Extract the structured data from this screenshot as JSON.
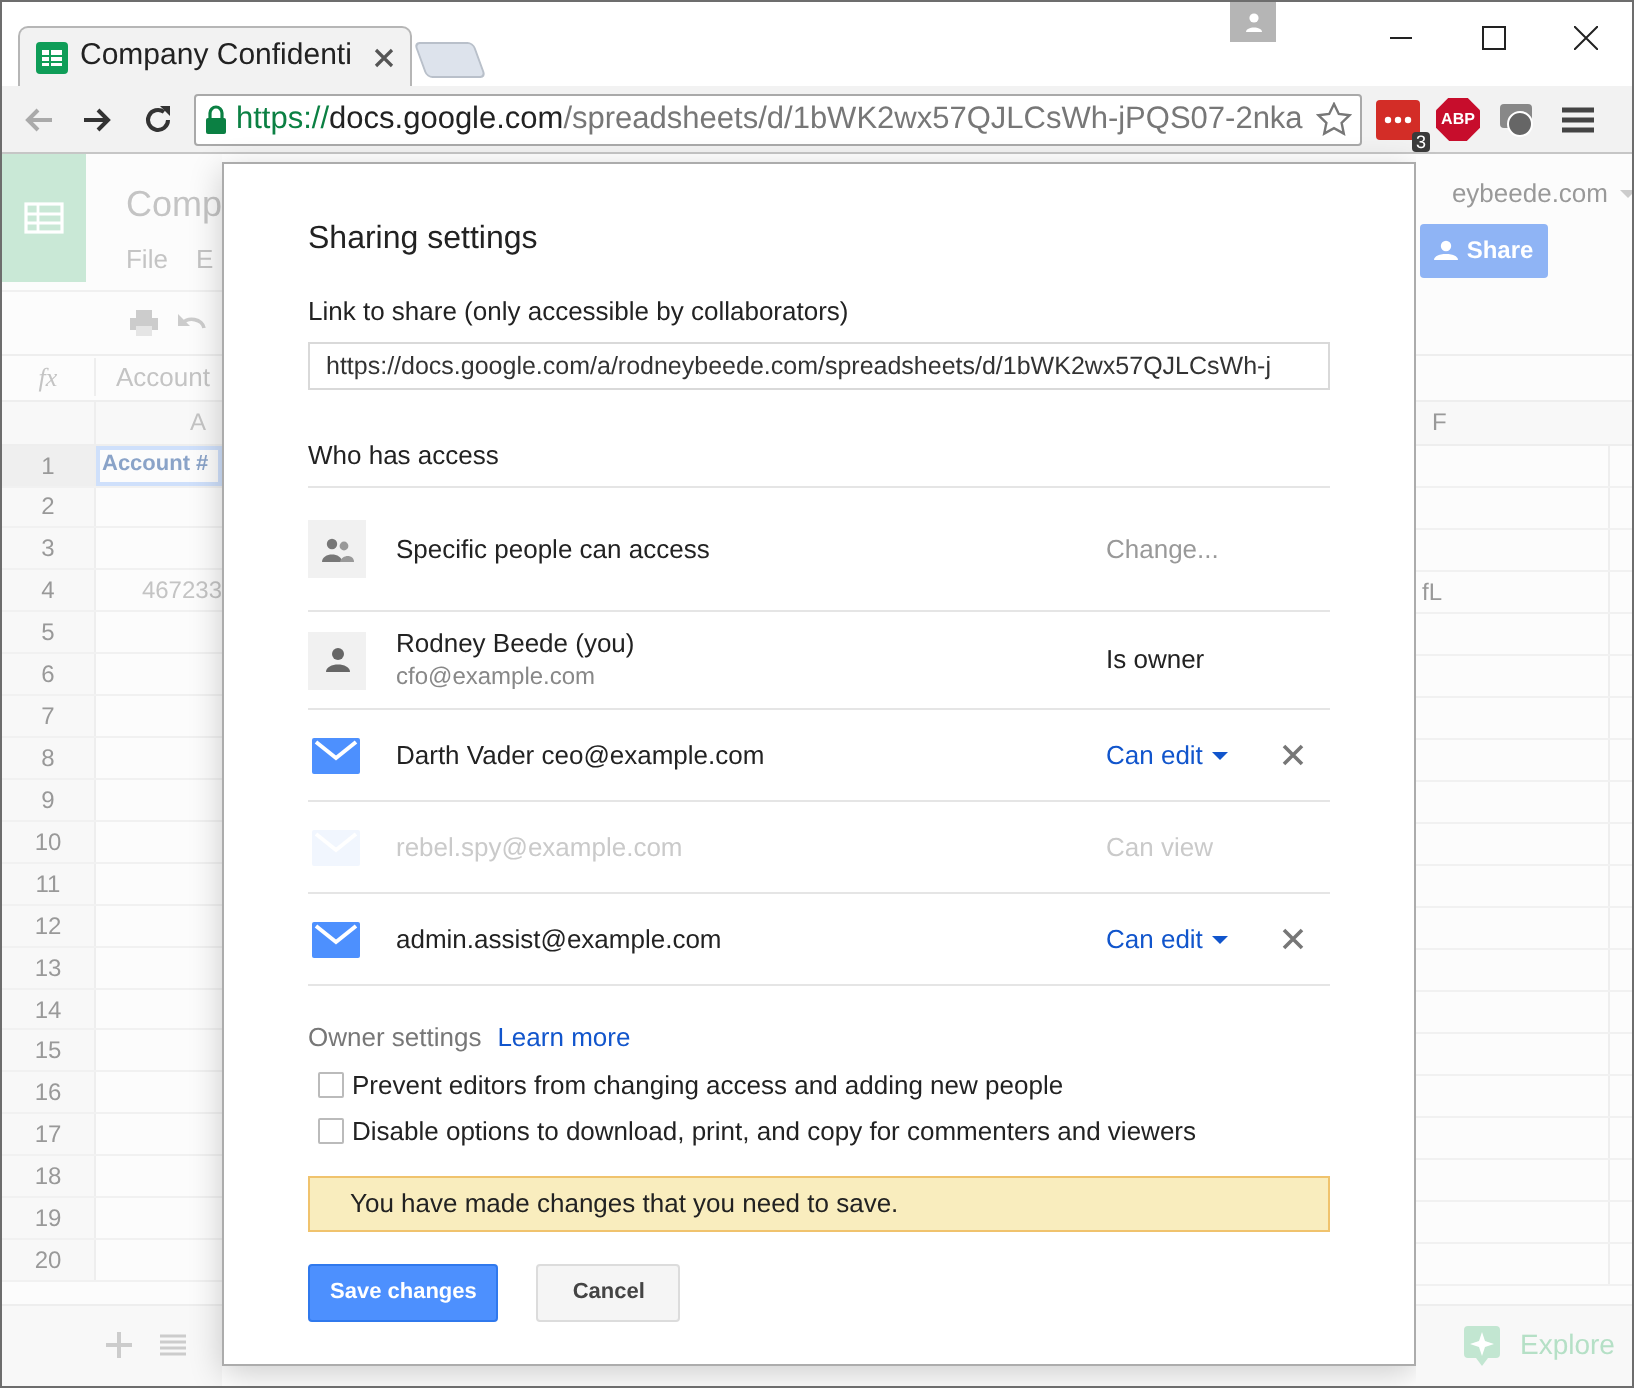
{
  "browser": {
    "tab": {
      "title": "Company Confidenti",
      "selected": true
    },
    "url": {
      "scheme": "https://",
      "host": "docs.google.com",
      "path": "/spreadsheets/d/1bWK2wx57QJLCsWh-jPQS07-2nka"
    },
    "extension_badge": "3",
    "adblock_label": "ABP"
  },
  "sheet": {
    "title": "Comp",
    "menu": [
      "File",
      "E"
    ],
    "formula_label": "fx",
    "formula_value": "Account",
    "left_column": "A",
    "right_column": "F",
    "account": "eybeede.com",
    "share_button": "Share",
    "explore": "Explore",
    "rows": [
      {
        "number": "1",
        "a": "Account #",
        "selected": true
      },
      {
        "number": "2",
        "selected": false
      },
      {
        "number": "3",
        "selected": false
      },
      {
        "number": "4",
        "a": "467233",
        "f": "fL",
        "selected": false
      },
      {
        "number": "5",
        "selected": false
      },
      {
        "number": "6",
        "selected": false
      },
      {
        "number": "7",
        "selected": false
      },
      {
        "number": "8",
        "selected": false
      },
      {
        "number": "9",
        "selected": false
      },
      {
        "number": "10",
        "selected": false
      },
      {
        "number": "11",
        "selected": false
      },
      {
        "number": "12",
        "selected": false
      },
      {
        "number": "13",
        "selected": false
      },
      {
        "number": "14",
        "selected": false
      },
      {
        "number": "15",
        "selected": false
      },
      {
        "number": "16",
        "selected": false
      },
      {
        "number": "17",
        "selected": false
      },
      {
        "number": "18",
        "selected": false
      },
      {
        "number": "19",
        "selected": false
      },
      {
        "number": "20",
        "selected": false
      }
    ]
  },
  "dialog": {
    "title": "Sharing settings",
    "link_label": "Link to share (only accessible by collaborators)",
    "link_value": "https://docs.google.com/a/rodneybeede.com/spreadsheets/d/1bWK2wx57QJLCsWh-j",
    "access_heading": "Who has access",
    "access": [
      {
        "kind": "visibility",
        "name": "Specific people can access",
        "role": "Change..."
      },
      {
        "kind": "person",
        "name": "Rodney Beede (you)",
        "email": "cfo@example.com",
        "role": "Is owner"
      },
      {
        "kind": "invite",
        "name": "Darth Vader ceo@example.com",
        "role": "Can edit",
        "disabled": false
      },
      {
        "kind": "invite",
        "name": "rebel.spy@example.com",
        "role": "Can view",
        "disabled": true
      },
      {
        "kind": "invite",
        "name": "admin.assist@example.com",
        "role": "Can edit",
        "disabled": false
      }
    ],
    "owner_settings": "Owner settings",
    "learn_more": "Learn more",
    "options": [
      {
        "label": "Prevent editors from changing access and adding new people",
        "checked": false
      },
      {
        "label": "Disable options to download, print, and copy for commenters and viewers",
        "checked": false
      }
    ],
    "notice": "You have made changes that you need to save.",
    "save_button": "Save changes",
    "cancel_button": "Cancel"
  }
}
